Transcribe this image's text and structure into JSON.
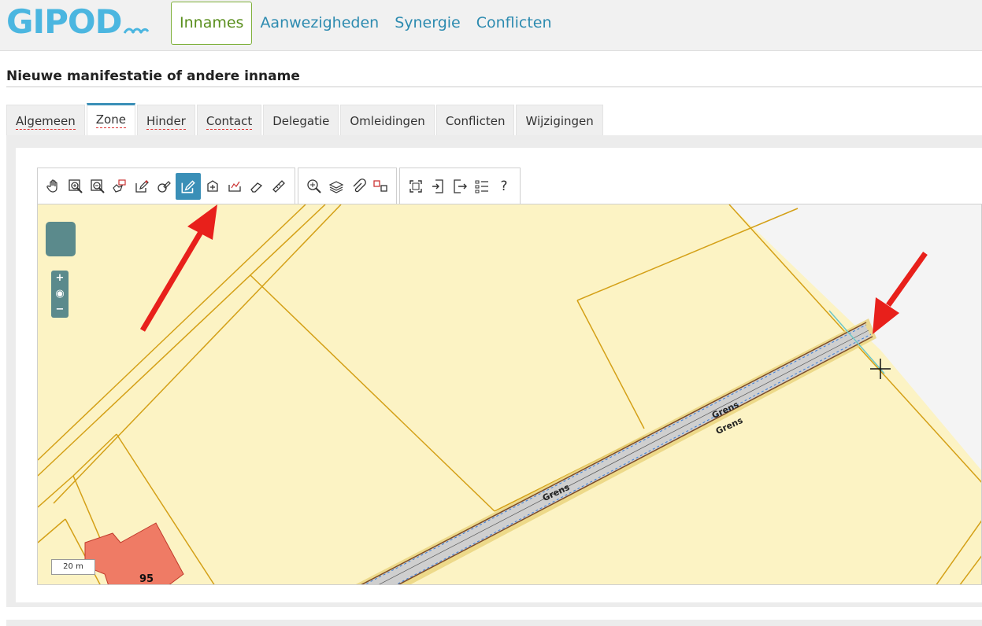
{
  "app": {
    "logo": "GIPOD"
  },
  "nav": {
    "items": [
      "Innames",
      "Aanwezigheden",
      "Synergie",
      "Conflicten"
    ]
  },
  "page": {
    "title": "Nieuwe manifestatie of andere inname"
  },
  "tabs": [
    "Algemeen",
    "Zone",
    "Hinder",
    "Contact",
    "Delegatie",
    "Omleidingen",
    "Conflicten",
    "Wijzigingen"
  ],
  "toolbar": {
    "tools": [
      "pan-hand-icon",
      "zoom-in-box-icon",
      "zoom-out-box-icon",
      "select-hand-icon",
      "draw-edit-icon",
      "draw-point-icon",
      "draw-line-icon",
      "draw-polygon-icon",
      "import-shape-icon",
      "eraser-icon",
      "measure-ruler-icon",
      "search-map-icon",
      "layers-icon",
      "attach-icon",
      "swap-icon",
      "fullscreen-icon",
      "import-icon",
      "export-icon",
      "legend-icon",
      "help-icon"
    ],
    "help_label": "?"
  },
  "map": {
    "zoom_in": "+",
    "zoom_out": "−",
    "scale_label": "20 m",
    "parcel_number": "95",
    "road_label_1": "Grens",
    "road_label_2": "Grens",
    "road_label_3": "Grens"
  },
  "colors": {
    "accent": "#3a8fb7",
    "map_bg": "#fcf3c4",
    "parcel_line": "#d4a017",
    "building": "#ef7b65",
    "arrow": "#e8201b"
  }
}
